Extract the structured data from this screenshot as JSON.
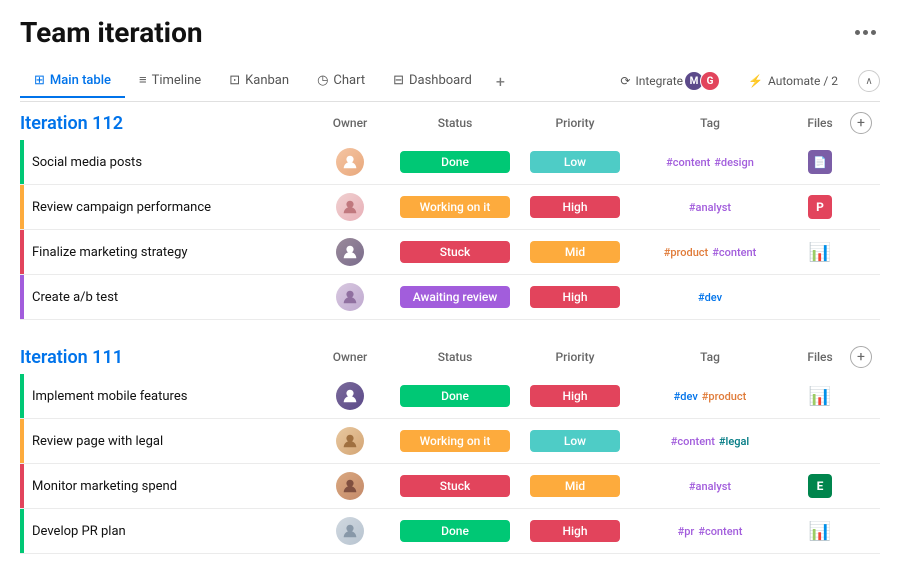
{
  "page": {
    "title": "Team iteration",
    "more_icon": "•••"
  },
  "tabs": [
    {
      "id": "main-table",
      "label": "Main table",
      "icon": "⊞",
      "active": true
    },
    {
      "id": "timeline",
      "label": "Timeline",
      "icon": "≡",
      "active": false
    },
    {
      "id": "kanban",
      "label": "Kanban",
      "icon": "⊡",
      "active": false
    },
    {
      "id": "chart",
      "label": "Chart",
      "icon": "◷",
      "active": false
    },
    {
      "id": "dashboard",
      "label": "Dashboard",
      "icon": "⊟",
      "active": false
    }
  ],
  "right_actions": {
    "integrate_label": "Integrate",
    "automate_label": "Automate / 2"
  },
  "columns": {
    "task": "",
    "owner": "Owner",
    "status": "Status",
    "priority": "Priority",
    "tag": "Tag",
    "files": "Files"
  },
  "iterations": [
    {
      "id": "iteration-112",
      "title": "Iteration 112",
      "rows": [
        {
          "id": "row-1",
          "indicator_color": "#00c875",
          "task": "Social media posts",
          "owner_color": "#e8a87c",
          "owner_initials": "👤",
          "status": "Done",
          "status_color": "#00c875",
          "priority": "Low",
          "priority_color": "#4eccc6",
          "tags": [
            {
              "label": "#content",
              "class": "tag-purple"
            },
            {
              "label": "#design",
              "class": "tag-purple"
            }
          ],
          "file_color": "#7b5ea7",
          "file_label": "📄"
        },
        {
          "id": "row-2",
          "indicator_color": "#fdab3d",
          "task": "Review campaign performance",
          "owner_color": "#e8b4b8",
          "owner_initials": "👤",
          "status": "Working on it",
          "status_color": "#fdab3d",
          "priority": "High",
          "priority_color": "#e2445c",
          "tags": [
            {
              "label": "#analyst",
              "class": "tag-purple"
            }
          ],
          "file_color": "#e2445c",
          "file_label": "P"
        },
        {
          "id": "row-3",
          "indicator_color": "#e2445c",
          "task": "Finalize marketing strategy",
          "owner_color": "#7b6d8d",
          "owner_initials": "👤",
          "status": "Stuck",
          "status_color": "#e2445c",
          "priority": "Mid",
          "priority_color": "#fdab3d",
          "tags": [
            {
              "label": "#product",
              "class": "tag-orange"
            },
            {
              "label": "#content",
              "class": "tag-purple"
            }
          ],
          "file_color": null,
          "file_label": "📊",
          "file_is_emoji": true
        },
        {
          "id": "row-4",
          "indicator_color": "#a25ddc",
          "task": "Create a/b test",
          "owner_color": "#c8b8d0",
          "owner_initials": "👤",
          "status": "Awaiting review",
          "status_color": "#a25ddc",
          "priority": "High",
          "priority_color": "#e2445c",
          "tags": [
            {
              "label": "#dev",
              "class": "tag-blue"
            }
          ],
          "file_color": null,
          "file_label": ""
        }
      ]
    },
    {
      "id": "iteration-111",
      "title": "Iteration 111",
      "rows": [
        {
          "id": "row-5",
          "indicator_color": "#00c875",
          "task": "Implement mobile features",
          "owner_color": "#5c4a8a",
          "owner_initials": "👤",
          "status": "Done",
          "status_color": "#00c875",
          "priority": "High",
          "priority_color": "#e2445c",
          "tags": [
            {
              "label": "#dev",
              "class": "tag-blue"
            },
            {
              "label": "#product",
              "class": "tag-orange"
            }
          ],
          "file_color": null,
          "file_label": "📊",
          "file_is_emoji": true
        },
        {
          "id": "row-6",
          "indicator_color": "#fdab3d",
          "task": "Review page with legal",
          "owner_color": "#d4a574",
          "owner_initials": "👤",
          "status": "Working on it",
          "status_color": "#fdab3d",
          "priority": "Low",
          "priority_color": "#4eccc6",
          "tags": [
            {
              "label": "#content",
              "class": "tag-purple"
            },
            {
              "label": "#legal",
              "class": "tag-teal"
            }
          ],
          "file_color": null,
          "file_label": ""
        },
        {
          "id": "row-7",
          "indicator_color": "#e2445c",
          "task": "Monitor marketing spend",
          "owner_color": "#c48a6a",
          "owner_initials": "👤",
          "status": "Stuck",
          "status_color": "#e2445c",
          "priority": "Mid",
          "priority_color": "#fdab3d",
          "tags": [
            {
              "label": "#analyst",
              "class": "tag-purple"
            }
          ],
          "file_color": "#00854d",
          "file_label": "E"
        },
        {
          "id": "row-8",
          "indicator_color": "#00c875",
          "task": "Develop PR plan",
          "owner_color": "#b8c4d0",
          "owner_initials": "👤",
          "status": "Done",
          "status_color": "#00c875",
          "priority": "High",
          "priority_color": "#e2445c",
          "tags": [
            {
              "label": "#pr",
              "class": "tag-purple"
            },
            {
              "label": "#content",
              "class": "tag-purple"
            }
          ],
          "file_color": null,
          "file_label": "📊",
          "file_is_emoji": true
        }
      ]
    }
  ]
}
